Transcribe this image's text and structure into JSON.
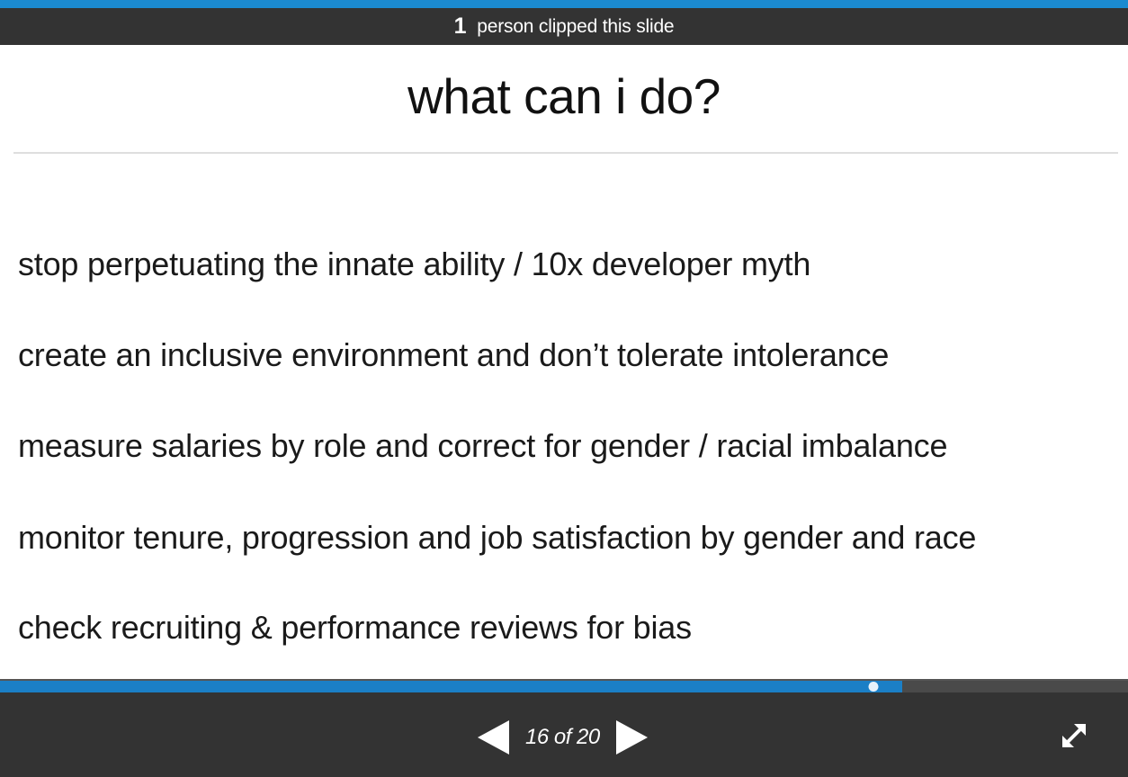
{
  "clip_bar": {
    "count": "1",
    "text": "person clipped this slide"
  },
  "slide": {
    "title": "what can i do?",
    "bullets": [
      "stop perpetuating the innate ability / 10x developer myth",
      "create an inclusive environment and don’t tolerate intolerance",
      "measure salaries by role and correct for gender / racial imbalance",
      "monitor tenure, progression and job satisfaction by gender and race",
      "check recruiting & performance reviews for bias"
    ]
  },
  "player": {
    "current_slide": 16,
    "total_slides": 20,
    "page_label": "16 of 20",
    "progress_fraction": 0.8,
    "icons": {
      "prev": "previous-slide-icon",
      "next": "next-slide-icon",
      "fullscreen": "fullscreen-expand-icon"
    },
    "colors": {
      "accent": "#1b8ad0",
      "bar": "#333333"
    }
  }
}
